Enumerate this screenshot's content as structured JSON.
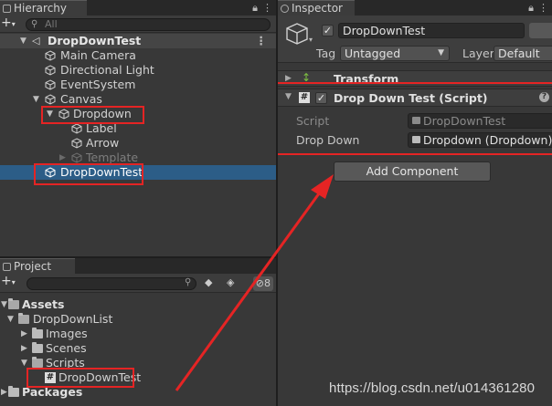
{
  "hierarchy": {
    "tab_label": "Hierarchy",
    "search_placeholder": "All",
    "scene_name": "DropDownTest",
    "items": [
      {
        "label": "Main Camera"
      },
      {
        "label": "Directional Light"
      },
      {
        "label": "EventSystem"
      },
      {
        "label": "Canvas"
      },
      {
        "label": "Dropdown"
      },
      {
        "label": "Label"
      },
      {
        "label": "Arrow"
      },
      {
        "label": "Template"
      },
      {
        "label": "DropDownTest"
      }
    ]
  },
  "project": {
    "tab_label": "Project",
    "hidden_count": "8",
    "items": [
      {
        "label": "Assets"
      },
      {
        "label": "DropDownList"
      },
      {
        "label": "Images"
      },
      {
        "label": "Scenes"
      },
      {
        "label": "Scripts"
      },
      {
        "label": "DropDownTest"
      },
      {
        "label": "Packages"
      }
    ]
  },
  "inspector": {
    "tab_label": "Inspector",
    "object_name": "DropDownTest",
    "tag_label": "Tag",
    "tag_value": "Untagged",
    "layer_label": "Layer",
    "layer_value": "Default",
    "transform_title": "Transform",
    "script_component_title": "Drop Down Test (Script)",
    "script_label": "Script",
    "script_value": "DropDownTest",
    "dropdown_label": "Drop Down",
    "dropdown_value": "Dropdown (Dropdown)",
    "add_component": "Add Component"
  },
  "watermark": "https://blog.csdn.net/u014361280",
  "colors": {
    "selection": "#2c5d87",
    "highlight_box": "#e52424",
    "panel_bg": "#383838"
  }
}
